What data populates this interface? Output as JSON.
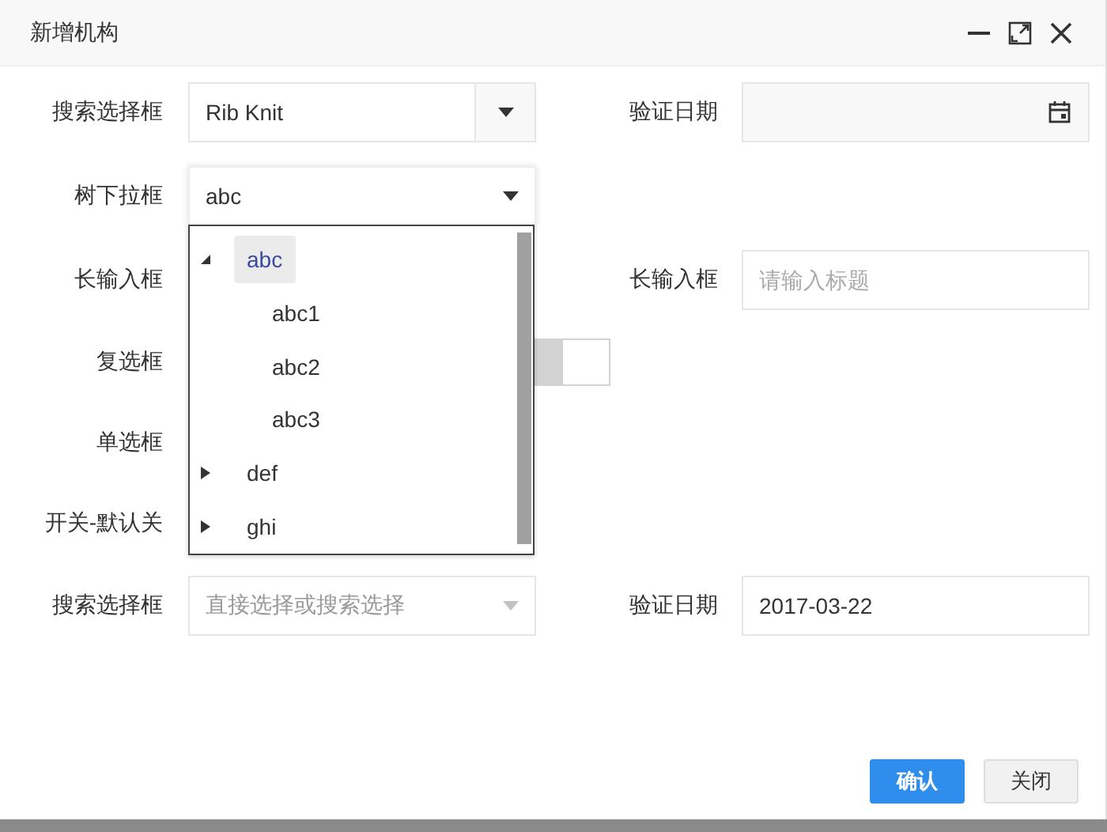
{
  "dialog": {
    "title": "新增机构"
  },
  "rows": [
    {
      "left": {
        "kind": "combo",
        "label": "搜索选择框",
        "value": "Rib Knit"
      },
      "right": {
        "kind": "date-picker",
        "label": "验证日期"
      }
    },
    {
      "left": {
        "kind": "tree-select",
        "label": "树下拉框",
        "value": "abc",
        "open": true,
        "options": [
          {
            "label": "abc",
            "expanded": true,
            "selected": true,
            "children": [
              {
                "label": "abc1",
                "selected": false
              },
              {
                "label": "abc2",
                "selected": false
              },
              {
                "label": "abc3",
                "selected": false
              }
            ]
          },
          {
            "label": "def",
            "expanded": false,
            "selected": false
          },
          {
            "label": "ghi",
            "expanded": false,
            "selected": false
          }
        ]
      }
    },
    {
      "left": {
        "kind": "label",
        "label": "长输入框"
      },
      "right": {
        "kind": "input",
        "label": "长输入框",
        "placeholder": "请输入标题"
      }
    },
    {
      "left": {
        "kind": "checkbox",
        "label": "复选框",
        "checked": false
      }
    },
    {
      "left": {
        "kind": "label",
        "label": "单选框"
      }
    },
    {
      "left": {
        "kind": "label",
        "label": "开关-默认关"
      }
    },
    {
      "left": {
        "kind": "select",
        "label": "搜索选择框",
        "placeholder": "直接选择或搜索选择"
      },
      "right": {
        "kind": "date",
        "label": "验证日期",
        "value": "2017-03-22"
      }
    }
  ],
  "buttons": [
    {
      "label": "确认",
      "kind": "primary"
    },
    {
      "label": "关闭",
      "kind": "default"
    }
  ]
}
